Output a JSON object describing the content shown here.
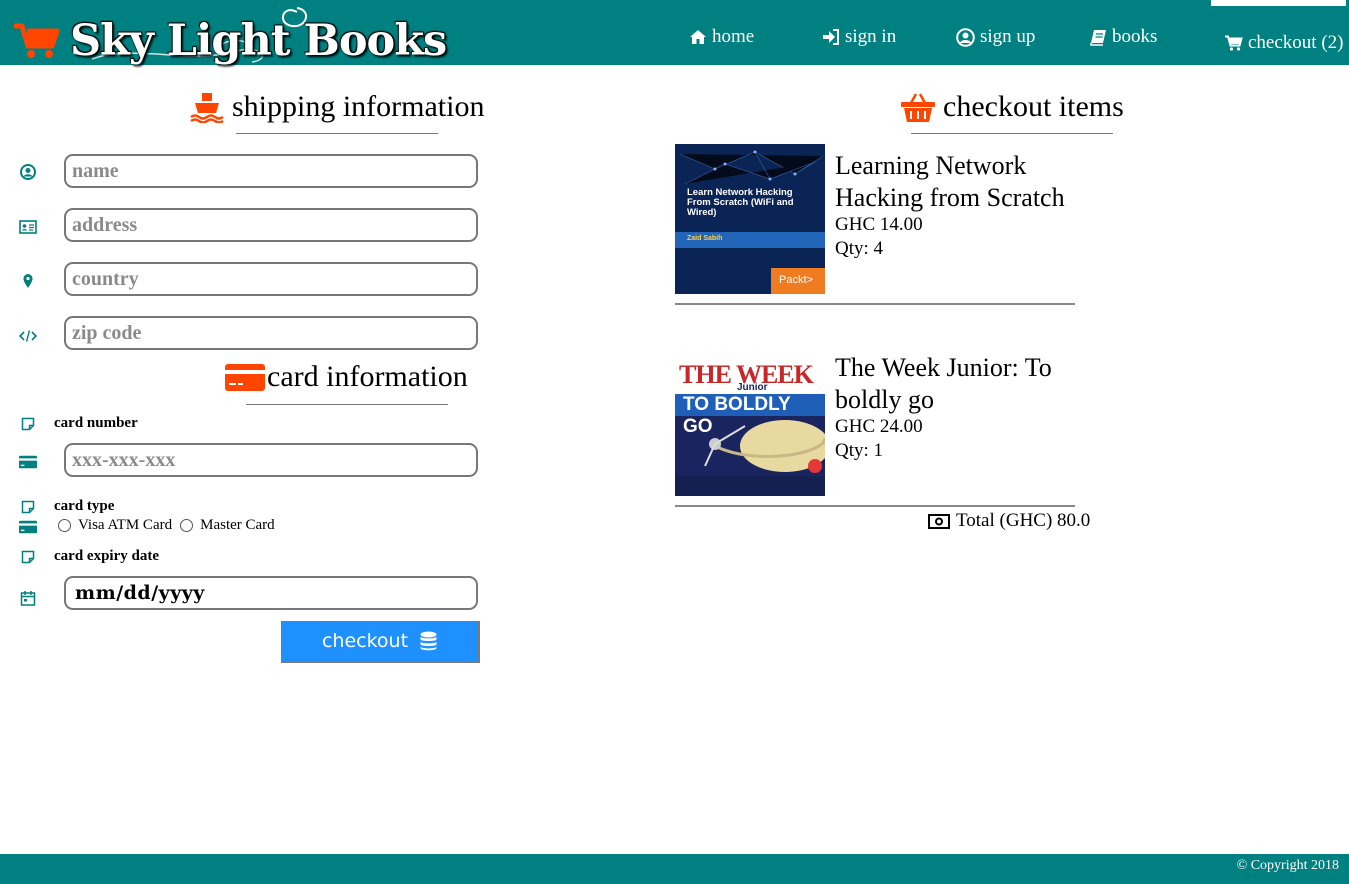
{
  "header": {
    "brand": "Sky Light Books",
    "nav": {
      "home": "home",
      "sign_in": "sign in",
      "sign_up": "sign up",
      "books": "books",
      "checkout": "checkout (2)"
    }
  },
  "shipping": {
    "heading": "shipping information",
    "name_placeholder": "name",
    "address_placeholder": "address",
    "country_placeholder": "country",
    "zip_placeholder": "zip code"
  },
  "card": {
    "heading": "card information",
    "number_label": "card number",
    "number_placeholder": "xxx-xxx-xxx",
    "type_label": "card type",
    "type_options": [
      "Visa ATM Card",
      "Master Card"
    ],
    "expiry_label": "card expiry date",
    "expiry_value": "mm/dd/yyyy",
    "submit_label": "checkout"
  },
  "cart": {
    "heading": "checkout items",
    "items": [
      {
        "title": "Learning Network Hacking from Scratch",
        "price": "GHC 14.00",
        "qty": "Qty: 4",
        "cover_text": "Learn Network Hacking From Scratch (WiFi and Wired)",
        "cover_author": "Zaid Sabih",
        "cover_publisher": "Packt>"
      },
      {
        "title": "The Week Junior: To boldly go",
        "price": "GHC 24.00",
        "qty": "Qty: 1",
        "cover_masthead": "THE WEEK",
        "cover_sub": "Junior",
        "cover_headline": "TO BOLDLY GO"
      }
    ],
    "total": "Total (GHC) 80.0"
  },
  "footer": {
    "copyright": "© Copyright 2018"
  },
  "colors": {
    "teal": "#008080",
    "accent_orange": "#ff4500",
    "button_blue": "#1e90ff"
  },
  "icons": [
    "cart-icon",
    "home-icon",
    "sign-in-icon",
    "user-circle-icon",
    "book-icon",
    "shopping-cart-icon",
    "ship-icon",
    "basket-icon",
    "user-icon",
    "id-card-icon",
    "map-marker-icon",
    "code-icon",
    "credit-card-icon",
    "sticky-note-icon",
    "calendar-icon",
    "database-icon",
    "money-icon"
  ]
}
